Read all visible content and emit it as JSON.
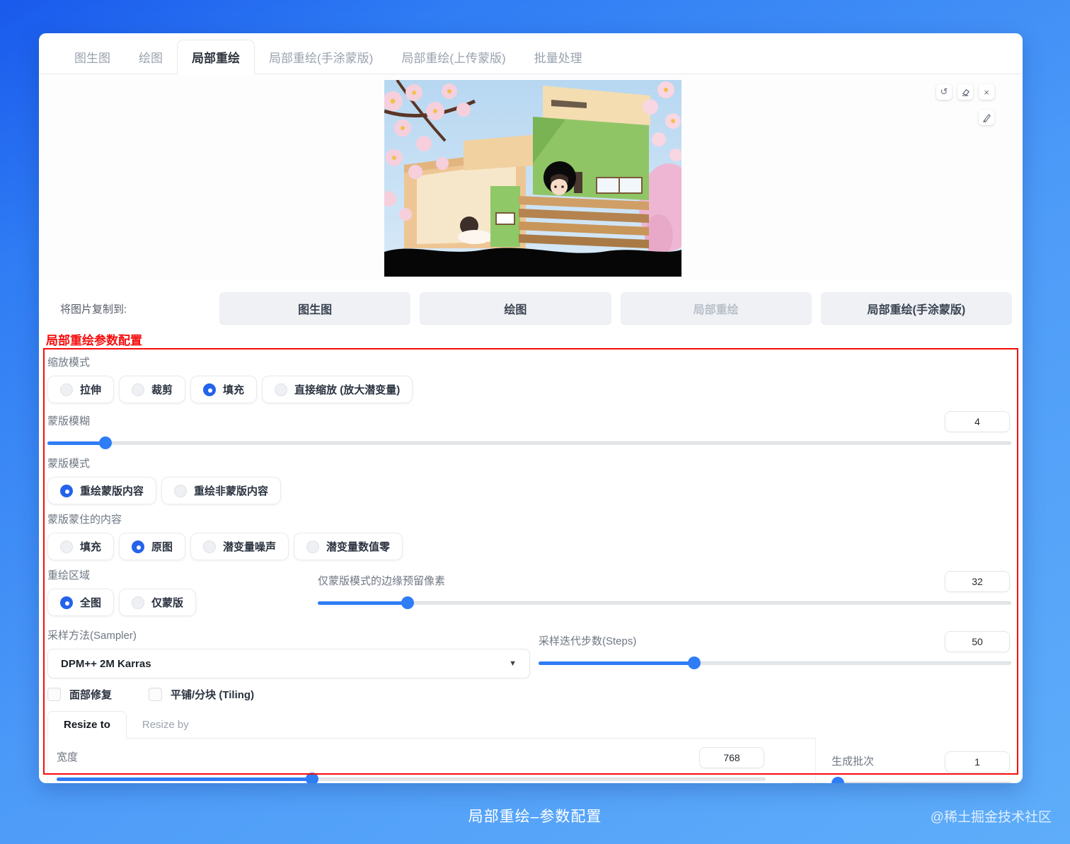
{
  "tab_bar": {
    "tabs": [
      "图生图",
      "绘图",
      "局部重绘",
      "局部重绘(手涂蒙版)",
      "局部重绘(上传蒙版)",
      "批量处理"
    ],
    "active": "局部重绘"
  },
  "preview_toolbar": {
    "undo_glyph": "↺",
    "close_glyph": "×",
    "icons": [
      "undo-icon",
      "eraser-icon",
      "close-icon",
      "brush-icon"
    ]
  },
  "copy_to": {
    "label": "将图片复制到:",
    "buttons": [
      "图生图",
      "绘图",
      "局部重绘",
      "局部重绘(手涂蒙版)"
    ],
    "disabled": "局部重绘"
  },
  "annotation": {
    "label": "局部重绘参数配置",
    "color": "#f70d0d"
  },
  "resize_mode": {
    "label": "缩放模式",
    "options": [
      "拉伸",
      "裁剪",
      "填充",
      "直接缩放 (放大潜变量)"
    ],
    "selected": "填充"
  },
  "mask_blur": {
    "label": "蒙版模糊",
    "value": "4"
  },
  "mask_mode": {
    "label": "蒙版模式",
    "options": [
      "重绘蒙版内容",
      "重绘非蒙版内容"
    ],
    "selected": "重绘蒙版内容"
  },
  "masked_content": {
    "label": "蒙版蒙住的内容",
    "options": [
      "填充",
      "原图",
      "潜变量噪声",
      "潜变量数值零"
    ],
    "selected": "原图"
  },
  "inpaint_area": {
    "label": "重绘区域",
    "options": [
      "全图",
      "仅蒙版"
    ],
    "selected": "全图"
  },
  "only_masked_padding": {
    "label": "仅蒙版模式的边缘预留像素",
    "value": "32"
  },
  "sampler": {
    "label": "采样方法(Sampler)",
    "value": "DPM++ 2M Karras"
  },
  "steps": {
    "label": "采样迭代步数(Steps)",
    "value": "50"
  },
  "checkboxes": {
    "restore_faces": "面部修复",
    "tiling": "平铺/分块 (Tiling)"
  },
  "resize_tabs": {
    "tabs": [
      "Resize to",
      "Resize by"
    ],
    "active": "Resize to"
  },
  "width": {
    "label": "宽度",
    "value": "768"
  },
  "batch_count": {
    "label": "生成批次",
    "value": "1"
  },
  "footer": {
    "caption": "局部重绘–参数配置",
    "watermark": "@稀土掘金技术社区"
  },
  "colors": {
    "accent_blue": "#2f7df6",
    "radio_checked": "#2563eb",
    "annotation_red": "#f70d0d"
  }
}
